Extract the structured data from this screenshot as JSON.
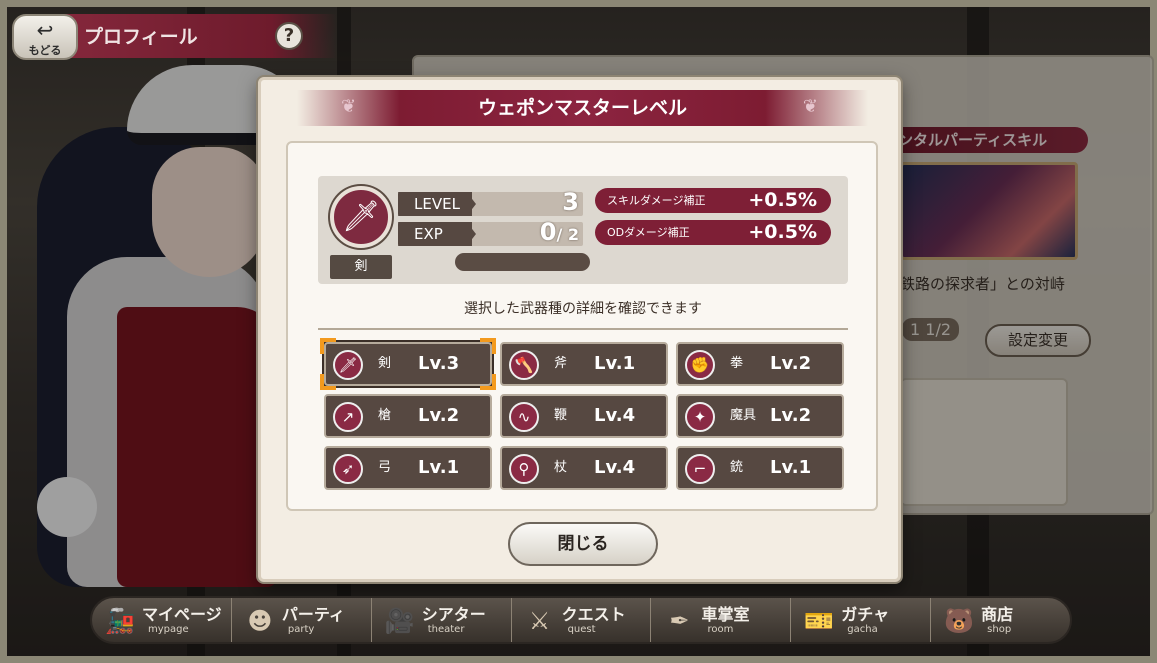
{
  "topbar": {
    "back_label": "もどる",
    "back_icon": "back-arrow-icon",
    "title": "プロフィール",
    "help_label": "?"
  },
  "background_panel": {
    "skill_header": "ンタルパーティスキル",
    "skill_name": "鉄路の探求者」との対峙",
    "party_count": "1/2",
    "party_prefix": "1",
    "setting_button": "設定変更"
  },
  "modal": {
    "title": "ウェポンマスターレベル",
    "weapon": {
      "name": "剣",
      "icon": "sword-icon"
    },
    "level_label": "LEVEL",
    "level_value": "3",
    "exp_label": "EXP",
    "exp_value": "0",
    "exp_max": "/ 2",
    "exp_progress": 0,
    "bonuses": [
      {
        "name": "スキルダメージ補正",
        "value": "+0.5%"
      },
      {
        "name": "ODダメージ補正",
        "value": "+0.5%"
      }
    ],
    "description": "選択した武器種の詳細を確認できます",
    "weapons": [
      {
        "name": "剣",
        "level": "Lv.3",
        "icon": "sword-icon",
        "selected": true
      },
      {
        "name": "斧",
        "level": "Lv.1",
        "icon": "axe-icon"
      },
      {
        "name": "拳",
        "level": "Lv.2",
        "icon": "fist-icon"
      },
      {
        "name": "槍",
        "level": "Lv.2",
        "icon": "spear-icon"
      },
      {
        "name": "鞭",
        "level": "Lv.4",
        "icon": "whip-icon"
      },
      {
        "name": "魔具",
        "level": "Lv.2",
        "icon": "magic-tool-icon"
      },
      {
        "name": "弓",
        "level": "Lv.1",
        "icon": "bow-icon"
      },
      {
        "name": "杖",
        "level": "Lv.4",
        "icon": "staff-icon"
      },
      {
        "name": "銃",
        "level": "Lv.1",
        "icon": "gun-icon"
      }
    ],
    "close_label": "閉じる"
  },
  "nav": [
    {
      "jp": "マイページ",
      "en": "mypage",
      "icon": "train-icon"
    },
    {
      "jp": "パーティ",
      "en": "party",
      "icon": "party-icon"
    },
    {
      "jp": "シアター",
      "en": "theater",
      "icon": "projector-icon"
    },
    {
      "jp": "クエスト",
      "en": "quest",
      "icon": "crossed-swords-icon"
    },
    {
      "jp": "車掌室",
      "en": "room",
      "icon": "quill-icon"
    },
    {
      "jp": "ガチャ",
      "en": "gacha",
      "icon": "ticket-icon"
    },
    {
      "jp": "商店",
      "en": "shop",
      "icon": "shop-bear-icon"
    }
  ]
}
